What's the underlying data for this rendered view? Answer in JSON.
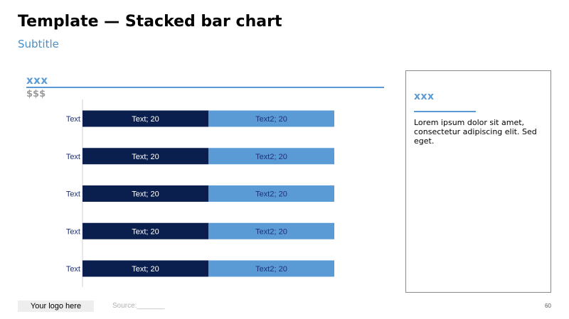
{
  "page": {
    "title": "Template — Stacked bar chart",
    "subtitle": "Subtitle",
    "page_number": "60"
  },
  "chart_header": {
    "label": "xxx",
    "unit": "$$$"
  },
  "side_panel": {
    "title": "xxx",
    "body": "Lorem ipsum dolor sit amet, consectetur adipiscing elit. Sed eget."
  },
  "footer": {
    "logo": "Your logo here",
    "source": "Source:_______"
  },
  "colors": {
    "series1": "#0b1f4f",
    "series2": "#5b9bd5",
    "accent": "#5b9bd5",
    "category_text": "#1f2f7a"
  },
  "chart_data": {
    "type": "bar",
    "orientation": "horizontal",
    "stacked": true,
    "categories": [
      "Text",
      "Text",
      "Text",
      "Text",
      "Text"
    ],
    "series": [
      {
        "name": "Text",
        "values": [
          20,
          20,
          20,
          20,
          20
        ]
      },
      {
        "name": "Text2",
        "values": [
          20,
          20,
          20,
          20,
          20
        ]
      }
    ],
    "data_label_format": "{series}; {value}",
    "xlim": [
      0,
      40
    ],
    "grid": false
  }
}
